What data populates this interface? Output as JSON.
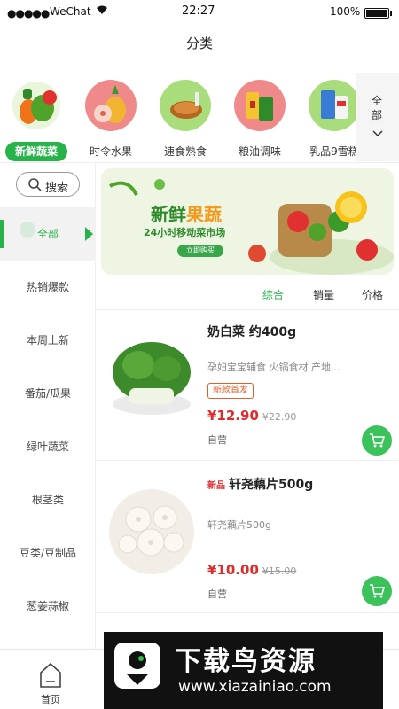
{
  "status_bar": {
    "signal": "●●●●●",
    "carrier": "WeChat",
    "time": "22:27",
    "battery": "100%"
  },
  "nav": {
    "title": "分类"
  },
  "categories": [
    {
      "label": "新鲜蔬菜",
      "active": true,
      "bg": "#8fd06a"
    },
    {
      "label": "时令水果",
      "active": false,
      "bg": "#f08a8a"
    },
    {
      "label": "速食熟食",
      "active": false,
      "bg": "#a9dc7a"
    },
    {
      "label": "粮油调味",
      "active": false,
      "bg": "#f08a8a"
    },
    {
      "label": "乳品9雪糕",
      "active": false,
      "bg": "#a9dc7a"
    }
  ],
  "more": {
    "label": "全部"
  },
  "sidebar": {
    "search_label": "搜索",
    "items": [
      {
        "label": "全部",
        "active": true
      },
      {
        "label": "热销爆款"
      },
      {
        "label": "本周上新"
      },
      {
        "label": "番茄/瓜果"
      },
      {
        "label": "绿叶蔬菜"
      },
      {
        "label": "根茎类"
      },
      {
        "label": "豆类/豆制品"
      },
      {
        "label": "葱姜蒜椒"
      }
    ]
  },
  "banner": {
    "title_a": "新鲜",
    "title_b": "果蔬",
    "subtitle": "24小时移动菜市场",
    "button": "立即购买"
  },
  "sort": {
    "s1": "综合",
    "s2": "销量",
    "s3": "价格"
  },
  "products": [
    {
      "name": "奶白菜 约400g",
      "tag": "",
      "desc": "孕妇宝宝辅食 火锅食材 产地...",
      "badge": "新款首发",
      "price": "¥12.90",
      "orig": "¥22.90",
      "seller": "自营"
    },
    {
      "name": "轩尧藕片500g",
      "tag": "新品",
      "desc": "轩尧藕片500g",
      "badge": "",
      "price": "¥10.00",
      "orig": "¥15.00",
      "seller": "自营"
    }
  ],
  "bottom_nav": {
    "home": "首页"
  },
  "watermark": {
    "brand": "下载鸟资源",
    "url": "www.xiazainiao.com"
  },
  "colors": {
    "accent": "#27b34a",
    "price": "#e02b2b",
    "cart": "#3cc25b"
  }
}
